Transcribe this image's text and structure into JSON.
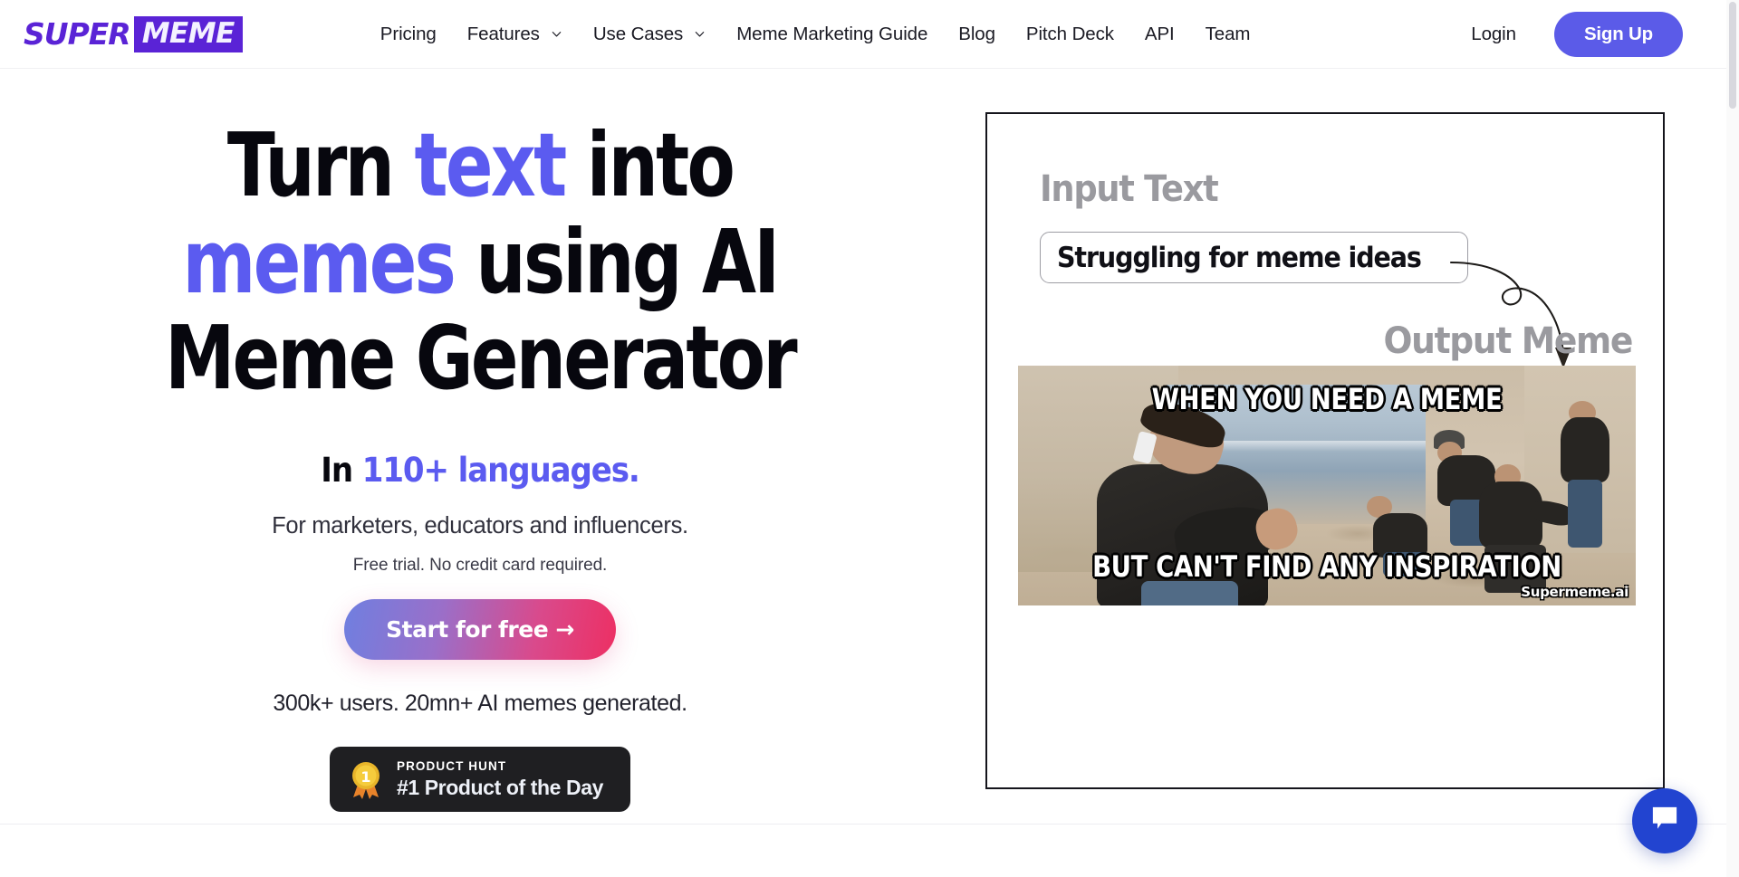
{
  "brand": {
    "logo_first": "SUPER",
    "logo_second": "MEME",
    "accent_purple": "#5A23D6",
    "accent_blue": "#5B5BF0",
    "signup_color": "#5B5BE8",
    "chat_color": "#2244D0"
  },
  "nav": {
    "items": [
      {
        "label": "Pricing",
        "has_dropdown": false
      },
      {
        "label": "Features",
        "has_dropdown": true,
        "icon": "chevron-down-icon"
      },
      {
        "label": "Use Cases",
        "has_dropdown": true,
        "icon": "chevron-down-icon"
      },
      {
        "label": "Meme Marketing Guide",
        "has_dropdown": false
      },
      {
        "label": "Blog",
        "has_dropdown": false
      },
      {
        "label": "Pitch Deck",
        "has_dropdown": false
      },
      {
        "label": "API",
        "has_dropdown": false
      },
      {
        "label": "Team",
        "has_dropdown": false
      }
    ],
    "login_label": "Login",
    "signup_label": "Sign Up"
  },
  "hero": {
    "headline_line1_a": "Turn ",
    "headline_line1_accent1": "text",
    "headline_line1_b": " into ",
    "headline_line1_accent2": "memes",
    "headline_line1_c": " using AI",
    "headline_line2": "Meme Generator",
    "languages_prefix": "In ",
    "languages_accent": "110+ languages.",
    "audience": "For marketers, educators and influencers.",
    "trial_note": "Free trial. No credit card required.",
    "cta_label": "Start for free →",
    "stats": "300k+ users. 20mn+ AI memes generated."
  },
  "product_hunt": {
    "icon": "gold-medal-icon",
    "kicker": "PRODUCT HUNT",
    "title": "#1 Product of the Day"
  },
  "demo": {
    "input_label": "Input Text",
    "input_value": "Struggling for meme ideas",
    "arrow_icon": "curved-loop-arrow-icon",
    "output_label": "Output Meme",
    "meme": {
      "top_caption": "WHEN YOU NEED A MEME",
      "bottom_caption": "BUT CAN'T FIND ANY INSPIRATION",
      "watermark": "Supermeme.ai"
    }
  },
  "chat": {
    "icon": "chat-bubble-icon"
  }
}
